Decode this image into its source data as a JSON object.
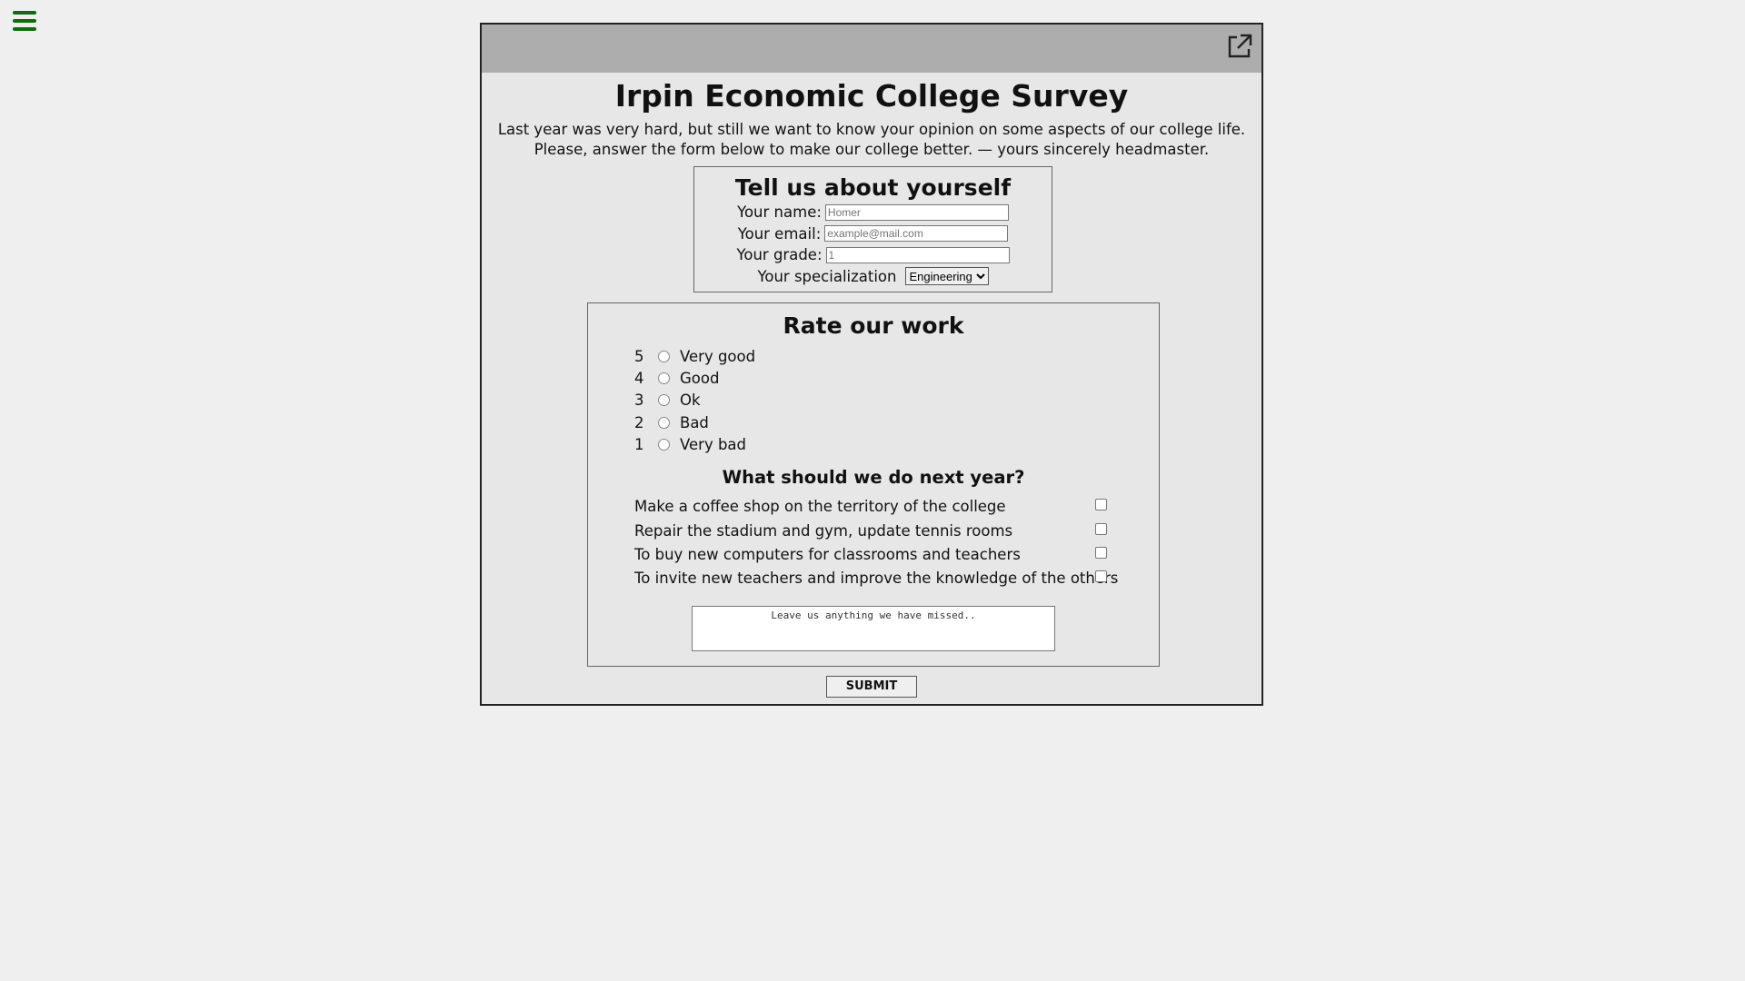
{
  "title": "Irpin Economic College Survey",
  "intro": {
    "line1": "Last year was very hard, but still we want to know your opinion on some aspects of our college life.",
    "line2": "Please, answer the form below to make our college better. — yours sincerely headmaster."
  },
  "about": {
    "heading": "Tell us about yourself",
    "name_label": "Your name:",
    "name_placeholder": "Homer",
    "email_label": "Your email:",
    "email_placeholder": "example@mail.com",
    "grade_label": "Your grade:",
    "grade_placeholder": "1",
    "spec_label": "Your specialization",
    "spec_selected": "Engineering"
  },
  "rate": {
    "heading": "Rate our work",
    "options": [
      {
        "num": "5",
        "label": "Very good"
      },
      {
        "num": "4",
        "label": "Good"
      },
      {
        "num": "3",
        "label": "Ok"
      },
      {
        "num": "2",
        "label": "Bad"
      },
      {
        "num": "1",
        "label": "Very bad"
      }
    ]
  },
  "next_year": {
    "heading": "What should we do next year?",
    "items": [
      "Make a coffee shop on the territory of the college",
      "Repair the stadium and gym, update tennis rooms",
      "To buy new computers for classrooms and teachers",
      "To invite new teachers and improve the knowledge of the others"
    ]
  },
  "comment_placeholder": "Leave us anything we have missed..",
  "submit_label": "SUBMIT",
  "colors": {
    "menu_icon": "#0f6a12",
    "frame_bg": "#e7e7e7",
    "topbar_bg": "#adadad"
  }
}
